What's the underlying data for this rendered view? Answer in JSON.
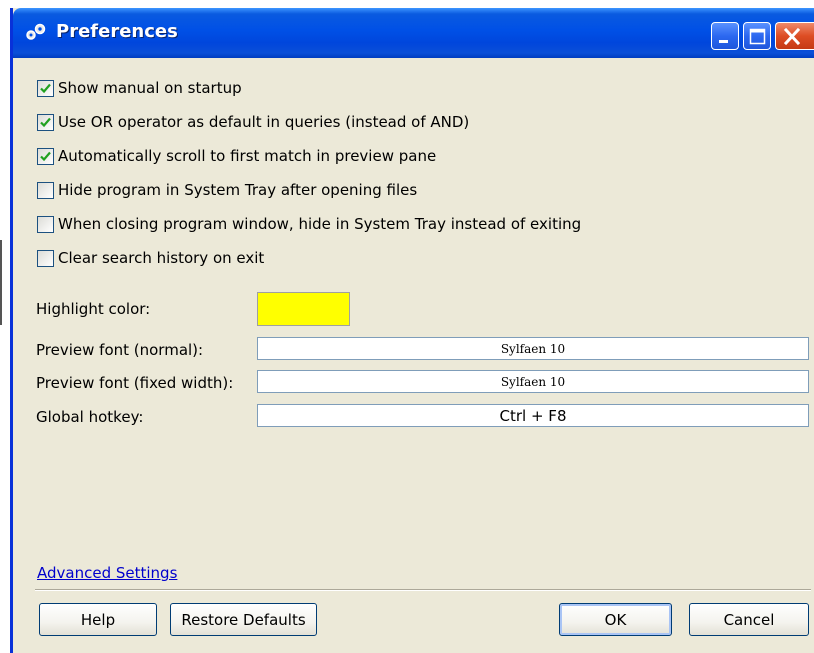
{
  "window": {
    "title": "Preferences",
    "controls": {
      "minimize_icon": "minimize-icon",
      "maximize_icon": "maximize-icon",
      "close_icon": "close-icon"
    }
  },
  "options": [
    {
      "label": "Show manual on startup",
      "checked": true
    },
    {
      "label": "Use OR operator as default in queries (instead of AND)",
      "checked": true
    },
    {
      "label": "Automatically scroll to first match in preview pane",
      "checked": true
    },
    {
      "label": "Hide program in System Tray after opening files",
      "checked": false
    },
    {
      "label": "When closing program window, hide in System Tray instead of exiting",
      "checked": false
    },
    {
      "label": "Clear search history on exit",
      "checked": false
    }
  ],
  "fields": {
    "highlight_color": {
      "label": "Highlight color:",
      "value": "#ffff00"
    },
    "preview_font_normal": {
      "label": "Preview font (normal):",
      "value": "Sylfaen 10"
    },
    "preview_font_fixed": {
      "label": "Preview font (fixed width):",
      "value": "Sylfaen 10"
    },
    "global_hotkey": {
      "label": "Global hotkey:",
      "value": "Ctrl + F8"
    }
  },
  "advanced_link": "Advanced Settings",
  "buttons": {
    "help": "Help",
    "restore_defaults": "Restore Defaults",
    "ok": "OK",
    "cancel": "Cancel"
  },
  "colors": {
    "titlebar": "#0050e6",
    "dialog_bg": "#ece9d8",
    "checkmark": "#21a121",
    "link": "#0000cc"
  }
}
